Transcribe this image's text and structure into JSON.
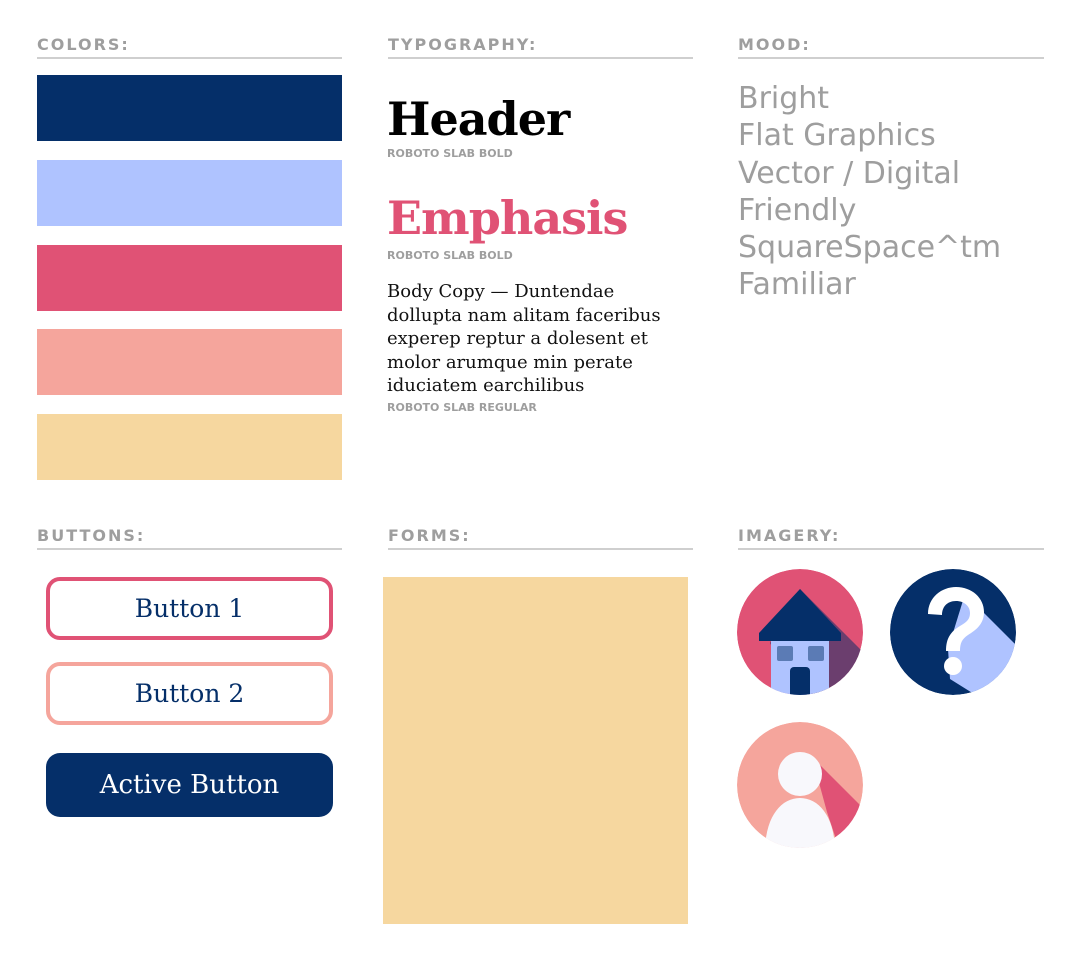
{
  "sections": {
    "colors": "COLORS:",
    "typography": "TYPOGRAPHY:",
    "mood": "MOOD:",
    "buttons": "BUTTONS:",
    "forms": "FORMS:",
    "imagery": "IMAGERY:"
  },
  "colors": [
    "#052f69",
    "#afc3ff",
    "#e05275",
    "#f5a59c",
    "#f6d79f"
  ],
  "typography": {
    "header_sample": "Header",
    "header_caption": "ROBOTO SLAB BOLD",
    "emphasis_sample": "Emphasis",
    "emphasis_caption": "ROBOTO SLAB BOLD",
    "body_sample": "Body Copy — Duntendae dollupta nam alitam faceribus experep reptur a dolesent et molor arumque min perate iduciatem earchilibus",
    "body_caption": "ROBOTO SLAB REGULAR"
  },
  "mood": [
    "Bright",
    "Flat Graphics",
    "Vector / Digital",
    "Friendly",
    "SquareSpace^tm",
    "Familiar"
  ],
  "buttons": {
    "button1": "Button 1",
    "button2": "Button 2",
    "active": "Active Button"
  },
  "forms": {
    "color": "#f6d79f"
  },
  "imagery": {
    "icons": [
      "house-icon",
      "question-mark-icon",
      "person-icon"
    ]
  }
}
